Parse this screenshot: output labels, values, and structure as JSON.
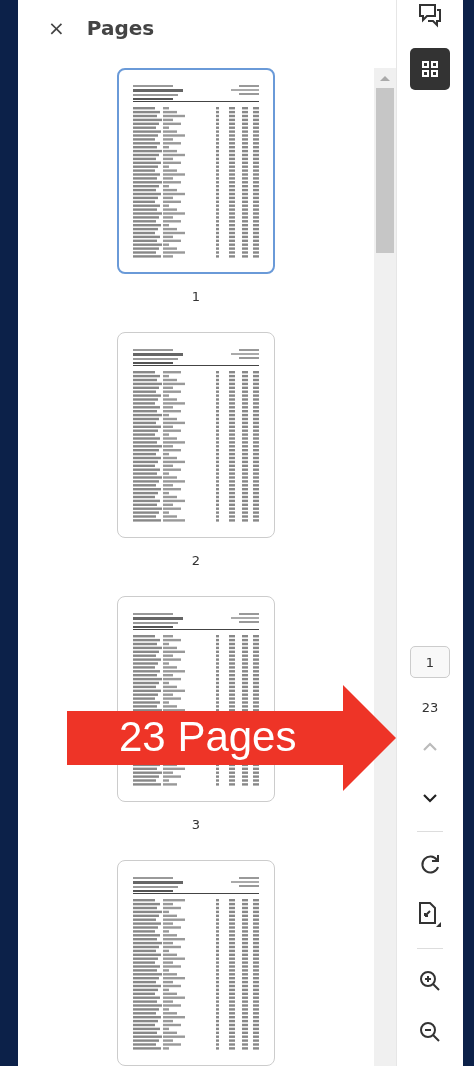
{
  "panel": {
    "close": "×",
    "title": "Pages"
  },
  "thumbnails": [
    {
      "label": "1",
      "selected": true
    },
    {
      "label": "2",
      "selected": false
    },
    {
      "label": "3",
      "selected": false
    },
    {
      "selected": false
    }
  ],
  "toolbar": {
    "top": [
      {
        "kind": "comments",
        "selected": false
      },
      {
        "kind": "thumbnails",
        "selected": true
      }
    ],
    "page_input": {
      "value": "1"
    },
    "page_total": "23",
    "tools": [
      {
        "kind": "prev",
        "disabled": true
      },
      {
        "kind": "next",
        "disabled": false
      },
      {
        "kind": "divider"
      },
      {
        "kind": "rotate"
      },
      {
        "kind": "fit"
      },
      {
        "kind": "divider"
      },
      {
        "kind": "zoom-in"
      },
      {
        "kind": "zoom-out"
      }
    ]
  },
  "annotation": {
    "text": "23 Pages"
  }
}
